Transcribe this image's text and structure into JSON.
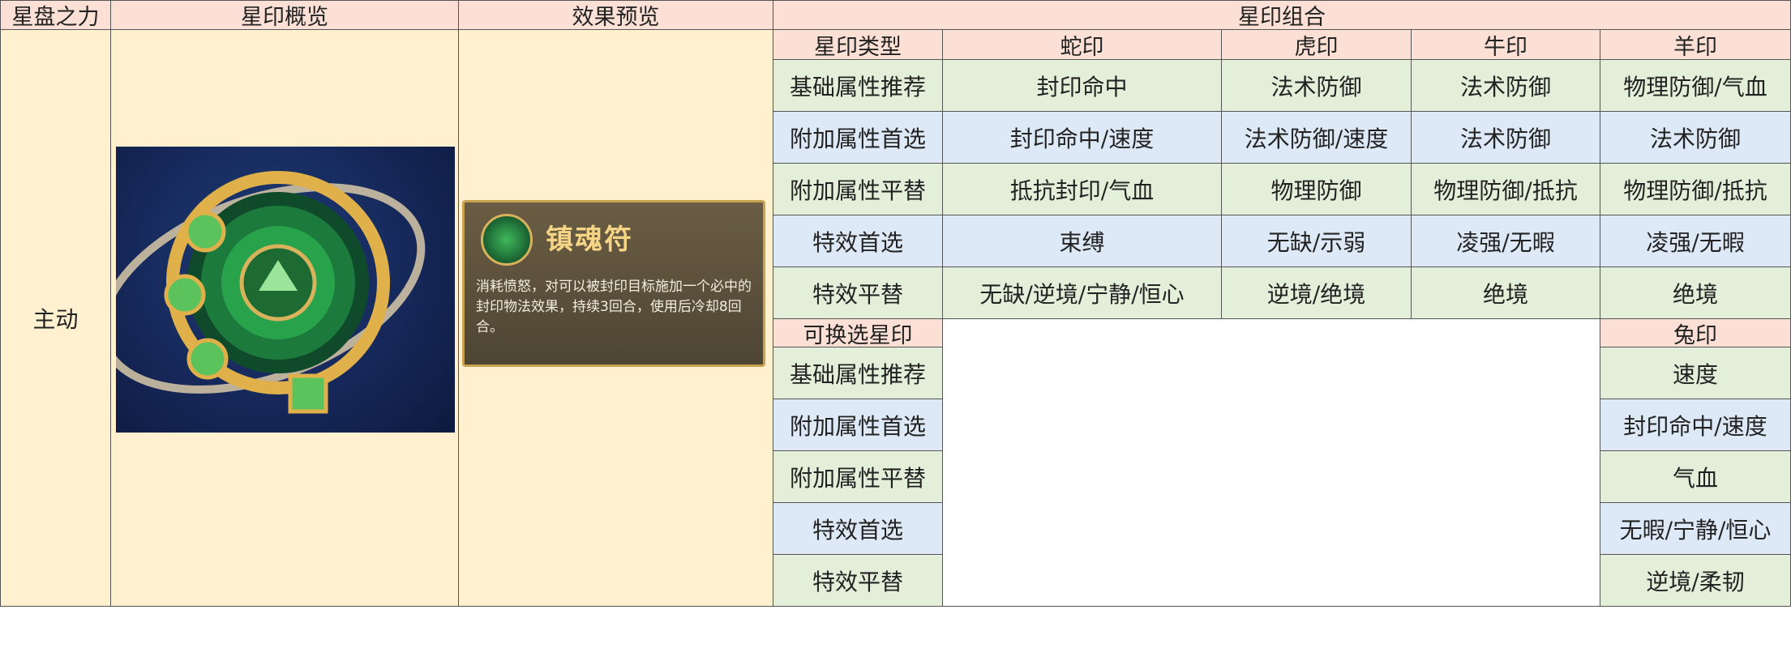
{
  "header": {
    "col_star_power": "星盘之力",
    "col_overview": "星印概览",
    "col_effect": "效果预览",
    "col_combo": "星印组合"
  },
  "row_label": "主动",
  "effect_card": {
    "name": "镇魂符",
    "description": "消耗愤怒，对可以被封印目标施加一个必中的封印物法效果，持续3回合，使用后冷却8回合。"
  },
  "combo": {
    "type_header": "星印类型",
    "seals": [
      "蛇印",
      "虎印",
      "牛印",
      "羊印"
    ],
    "attributes": [
      "基础属性推荐",
      "附加属性首选",
      "附加属性平替",
      "特效首选",
      "特效平替"
    ],
    "rows": [
      [
        "封印命中",
        "法术防御",
        "法术防御",
        "物理防御/气血"
      ],
      [
        "封印命中/速度",
        "法术防御/速度",
        "法术防御",
        "法术防御"
      ],
      [
        "抵抗封印/气血",
        "物理防御",
        "物理防御/抵抗",
        "物理防御/抵抗"
      ],
      [
        "束缚",
        "无缺/示弱",
        "凌强/无暇",
        "凌强/无暇"
      ],
      [
        "无缺/逆境/宁静/恒心",
        "逆境/绝境",
        "绝境",
        "绝境"
      ]
    ],
    "alt_header": "可换选星印",
    "alt_seal": "兔印",
    "alt_values": [
      "速度",
      "封印命中/速度",
      "气血",
      "无暇/宁静/恒心",
      "逆境/柔韧"
    ]
  },
  "colors": {
    "header_bg": "#fce0d6",
    "cream_bg": "#fff1cf",
    "green_row": "#e3efd9",
    "blue_row": "#dde9f6"
  }
}
